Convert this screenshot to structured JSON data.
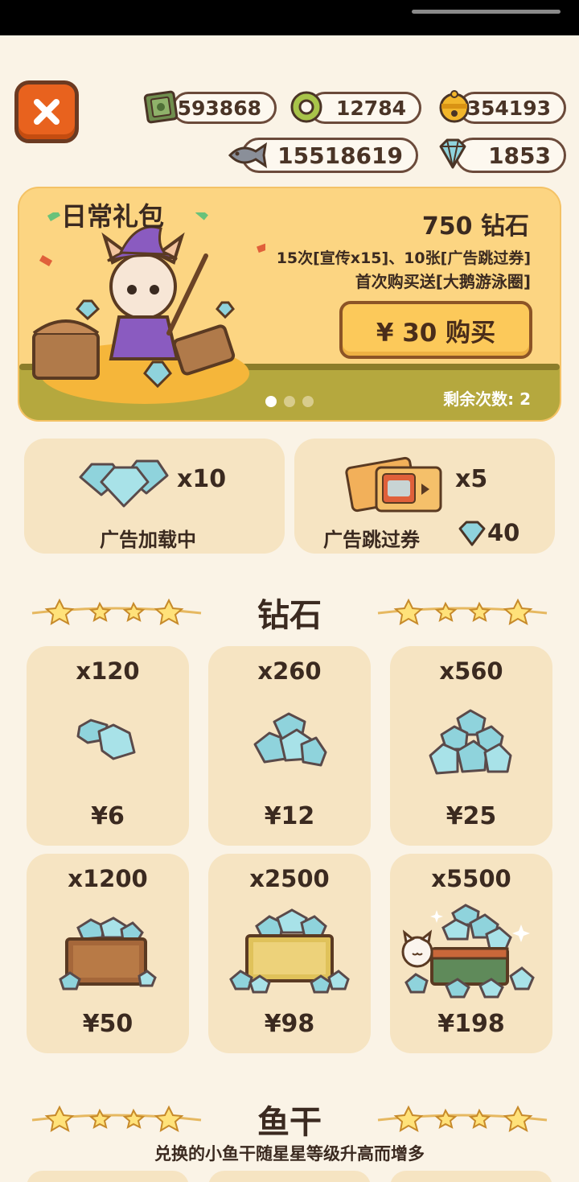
{
  "header": {
    "close_icon": "close-icon",
    "currencies": [
      {
        "icon": "cash-icon",
        "value": "593868"
      },
      {
        "icon": "ring-icon",
        "value": "12784"
      },
      {
        "icon": "bell-icon",
        "value": "354193"
      },
      {
        "icon": "fish-icon",
        "value": "15518619"
      },
      {
        "icon": "diamond-icon",
        "value": "1853"
      }
    ]
  },
  "banner": {
    "title": "日常礼包",
    "diamonds": "750 钻石",
    "line1": "15次[宣传x15]、10张[广告跳过券]",
    "line2": "首次购买送[大鹅游泳圈]",
    "buy_label": "¥ 30 购买",
    "remaining": "剩余次数: 2",
    "page_count": 3,
    "active_page": 1
  },
  "ad_cards": [
    {
      "qty": "x10",
      "label": "广告加载中"
    },
    {
      "qty": "x5",
      "label": "广告跳过券",
      "cost": "40"
    }
  ],
  "diamond_section": {
    "title": "钻石",
    "items": [
      {
        "qty": "x120",
        "price": "¥6"
      },
      {
        "qty": "x260",
        "price": "¥12"
      },
      {
        "qty": "x560",
        "price": "¥25"
      },
      {
        "qty": "x1200",
        "price": "¥50"
      },
      {
        "qty": "x2500",
        "price": "¥98"
      },
      {
        "qty": "x5500",
        "price": "¥198"
      }
    ]
  },
  "fish_section": {
    "title": "鱼干",
    "subtitle": "兑换的小鱼干随星星等级升高而增多"
  },
  "colors": {
    "background": "#faf3e6",
    "card": "#f6e4c2",
    "banner": "#fcd582",
    "close_button": "#e8621e",
    "diamond": "#8fd3dc"
  }
}
